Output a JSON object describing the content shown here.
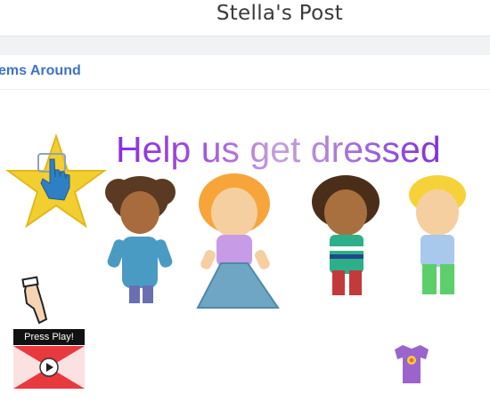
{
  "header": {
    "title": "Stella's Post"
  },
  "nav": {
    "link_label": "ems Around"
  },
  "activity": {
    "headline": "Help us get dressed",
    "press_play_label": "Press Play!"
  },
  "icons": {
    "touch": "hand-touch-icon",
    "pointer": "pointing-hand-icon",
    "video": "play-button-icon",
    "shirt": "purple-tshirt-icon"
  },
  "colors": {
    "accent_link": "#3c74c4",
    "star": "#f2cf2f",
    "headline_purple": "#8a2ee0",
    "video_red": "#e8393e"
  }
}
